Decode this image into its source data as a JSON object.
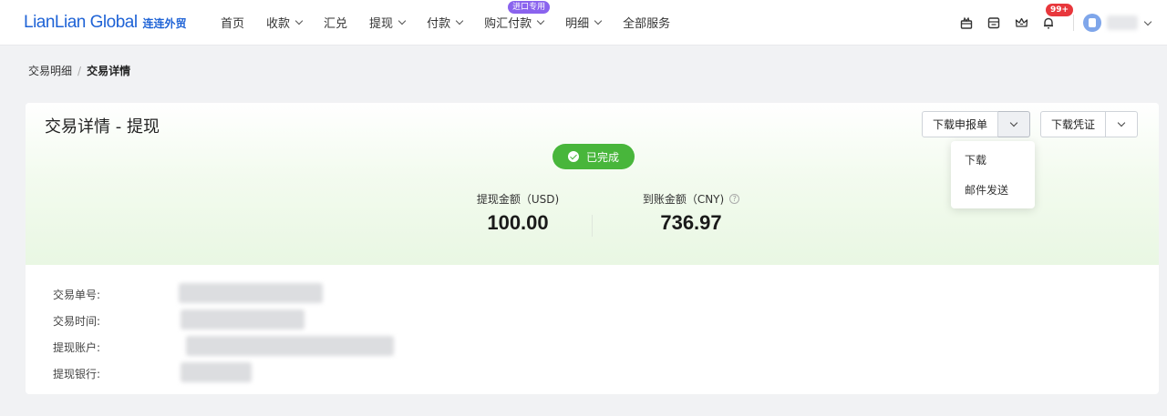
{
  "brand": {
    "name_en": "LianLian Global",
    "name_cn": "连连外贸",
    "color": "#1f63d6"
  },
  "nav": {
    "items": [
      {
        "label": "首页",
        "dropdown": false
      },
      {
        "label": "收款",
        "dropdown": true
      },
      {
        "label": "汇兑",
        "dropdown": false
      },
      {
        "label": "提现",
        "dropdown": true
      },
      {
        "label": "付款",
        "dropdown": true
      },
      {
        "label": "购汇付款",
        "dropdown": true,
        "badge": "进口专用"
      },
      {
        "label": "明细",
        "dropdown": true
      },
      {
        "label": "全部服务",
        "dropdown": false
      }
    ]
  },
  "header_tools": {
    "icons": [
      "gift-icon",
      "calendar-icon",
      "crown-icon",
      "bell-icon"
    ],
    "notification_badge": "99+"
  },
  "breadcrumb": {
    "parent": "交易明细",
    "separator": "/",
    "current": "交易详情"
  },
  "detail": {
    "title": "交易详情 - 提现",
    "status": "已完成",
    "status_color": "#48b63b",
    "withdraw_amount_label": "提现金额（USD)",
    "withdraw_amount": "100.00",
    "received_amount_label": "到账金额（CNY)",
    "received_amount": "736.97",
    "fields": [
      {
        "label": "交易单号:"
      },
      {
        "label": "交易时间:"
      },
      {
        "label": "提现账户:"
      },
      {
        "label": "提现银行:"
      }
    ]
  },
  "actions": {
    "download_declaration": "下载申报单",
    "download_voucher": "下载凭证",
    "menu": [
      "下载",
      "邮件发送"
    ]
  }
}
